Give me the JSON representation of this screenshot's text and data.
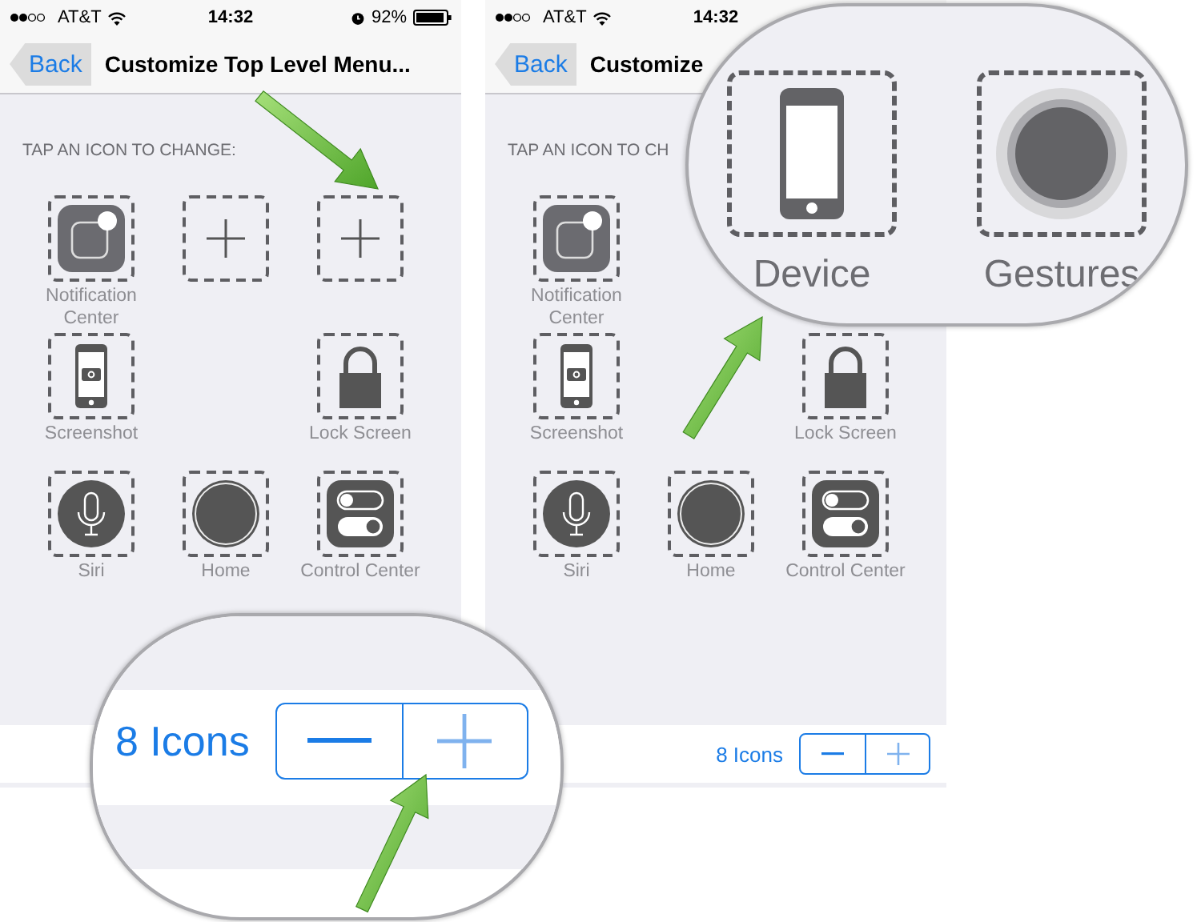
{
  "screens": [
    {
      "status_bar": {
        "carrier": "AT&T",
        "time": "14:32",
        "battery": "92%"
      },
      "nav": {
        "back": "Back",
        "title": "Customize Top Level Menu..."
      },
      "section_label": "TAP AN ICON TO CHANGE:",
      "icons": [
        {
          "kind": "notification",
          "label": "Notification Center"
        },
        {
          "kind": "add"
        },
        {
          "kind": "add"
        },
        {
          "kind": "screenshot",
          "label": "Screenshot"
        },
        {
          "kind": "empty"
        },
        {
          "kind": "lock",
          "label": "Lock Screen"
        },
        {
          "kind": "siri",
          "label": "Siri"
        },
        {
          "kind": "home",
          "label": "Home"
        },
        {
          "kind": "control",
          "label": "Control Center"
        }
      ]
    },
    {
      "status_bar": {
        "carrier": "AT&T",
        "time": "14:32"
      },
      "nav": {
        "back": "Back",
        "title": "Customize"
      },
      "section_label": "TAP AN ICON TO CH",
      "icons": [
        {
          "kind": "notification",
          "label": "Notification Center"
        },
        {
          "kind": "empty"
        },
        {
          "kind": "empty"
        },
        {
          "kind": "screenshot",
          "label": "Screenshot"
        },
        {
          "kind": "empty"
        },
        {
          "kind": "lock",
          "label": "Lock Screen"
        },
        {
          "kind": "siri",
          "label": "Siri"
        },
        {
          "kind": "home",
          "label": "Home"
        },
        {
          "kind": "control",
          "label": "Control Center"
        }
      ],
      "footer": {
        "count": "8 Icons"
      }
    }
  ],
  "callouts": [
    {
      "kind": "stepper",
      "count": "8 Icons"
    },
    {
      "kind": "icons",
      "items": [
        {
          "kind": "device",
          "label": "Device"
        },
        {
          "kind": "gestures",
          "label": "Gestures"
        }
      ]
    }
  ]
}
